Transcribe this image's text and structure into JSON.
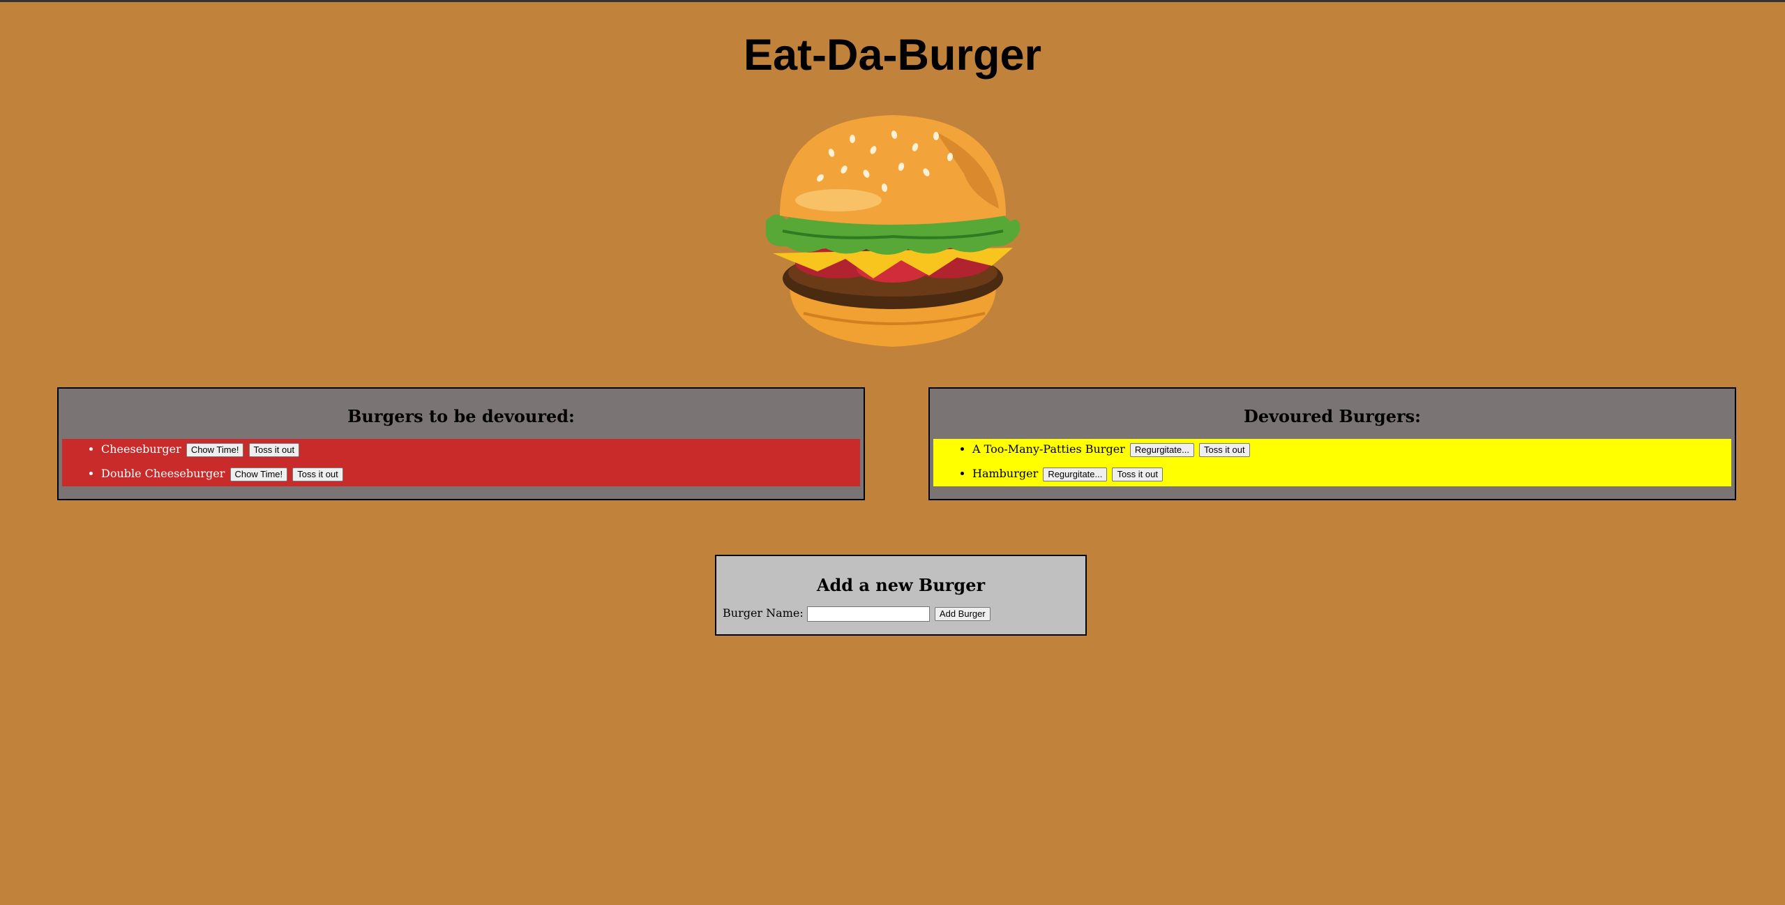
{
  "header": {
    "title": "Eat-Da-Burger"
  },
  "logo": {
    "icon": "burger-illustration"
  },
  "to_devour": {
    "heading": "Burgers to be devoured:",
    "background": "#c92b2b",
    "items": [
      {
        "name": "Cheeseburger",
        "eat_label": "Chow Time!",
        "delete_label": "Toss it out"
      },
      {
        "name": "Double Cheeseburger",
        "eat_label": "Chow Time!",
        "delete_label": "Toss it out"
      }
    ]
  },
  "devoured": {
    "heading": "Devoured Burgers:",
    "background": "#ffff00",
    "items": [
      {
        "name": "A Too-Many-Patties Burger",
        "undo_label": "Regurgitate...",
        "delete_label": "Toss it out"
      },
      {
        "name": "Hamburger",
        "undo_label": "Regurgitate...",
        "delete_label": "Toss it out"
      }
    ]
  },
  "add_form": {
    "heading": "Add a new Burger",
    "field_label": "Burger Name:",
    "field_value": "",
    "submit_label": "Add Burger"
  },
  "colors": {
    "page_background": "#c1823b",
    "panel_background": "#7a7474",
    "form_background": "#c0c0c0"
  }
}
